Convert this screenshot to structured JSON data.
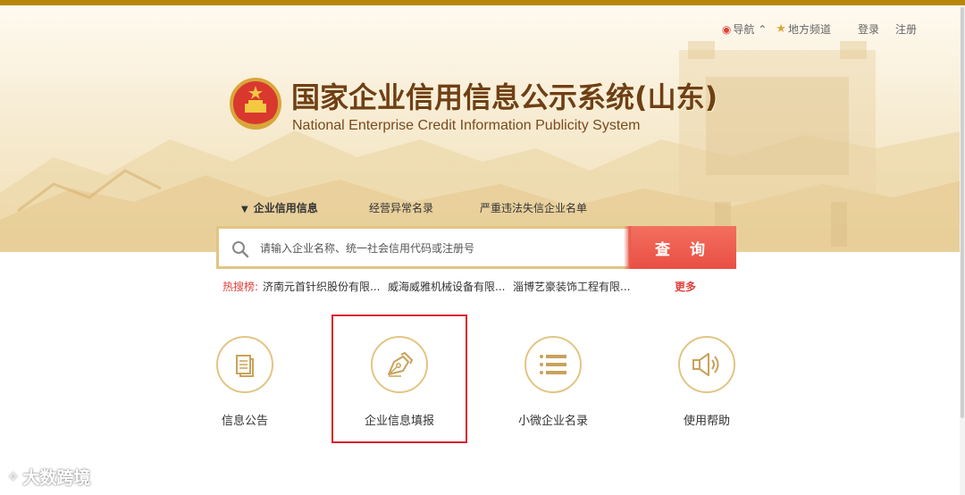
{
  "top_nav": {
    "navigation": "导航",
    "local_channel": "地方频道",
    "login": "登录",
    "register": "注册"
  },
  "header": {
    "title_cn": "国家企业信用信息公示系统(山东)",
    "title_en": "National Enterprise Credit Information Publicity System"
  },
  "tabs": [
    {
      "label": "企业信用信息",
      "active": true
    },
    {
      "label": "经营异常名录",
      "active": false
    },
    {
      "label": "严重违法失信企业名单",
      "active": false
    }
  ],
  "search": {
    "placeholder": "请输入企业名称、统一社会信用代码或注册号",
    "button_label": "查 询"
  },
  "hot_search": {
    "label": "热搜榜:",
    "items": [
      "济南元首针织股份有限...",
      "威海威雅机械设备有限...",
      "淄博艺豪装饰工程有限..."
    ],
    "more": "更多"
  },
  "services": [
    {
      "label": "信息公告",
      "icon": "document-icon"
    },
    {
      "label": "企业信息填报",
      "icon": "pen-nib-icon",
      "highlighted": true
    },
    {
      "label": "小微企业名录",
      "icon": "list-icon"
    },
    {
      "label": "使用帮助",
      "icon": "speaker-icon"
    }
  ],
  "watermark": "大数跨境",
  "colors": {
    "accent_gold": "#e2c583",
    "search_button": "#e94f45",
    "hot_label": "#e0413a",
    "title_brown": "#6f3f16",
    "highlight_border": "#d9232d"
  }
}
